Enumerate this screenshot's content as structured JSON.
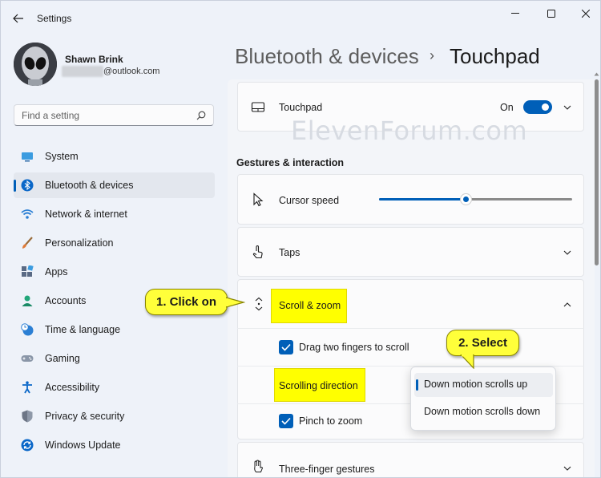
{
  "window": {
    "title": "Settings"
  },
  "profile": {
    "name": "Shawn Brink",
    "email_suffix": "@outlook.com"
  },
  "search": {
    "placeholder": "Find a setting"
  },
  "nav": {
    "items": [
      {
        "label": "System",
        "icon": "system-icon"
      },
      {
        "label": "Bluetooth & devices",
        "icon": "bluetooth-icon",
        "selected": true
      },
      {
        "label": "Network & internet",
        "icon": "wifi-icon"
      },
      {
        "label": "Personalization",
        "icon": "brush-icon"
      },
      {
        "label": "Apps",
        "icon": "apps-icon"
      },
      {
        "label": "Accounts",
        "icon": "person-icon"
      },
      {
        "label": "Time & language",
        "icon": "clock-globe-icon"
      },
      {
        "label": "Gaming",
        "icon": "gamepad-icon"
      },
      {
        "label": "Accessibility",
        "icon": "accessibility-icon"
      },
      {
        "label": "Privacy & security",
        "icon": "shield-icon"
      },
      {
        "label": "Windows Update",
        "icon": "update-icon"
      }
    ]
  },
  "breadcrumb": {
    "parent": "Bluetooth & devices",
    "separator": "›",
    "current": "Touchpad"
  },
  "touchpad": {
    "label": "Touchpad",
    "toggle_state": "On",
    "toggle_on": true
  },
  "gestures": {
    "section_title": "Gestures & interaction",
    "cursor_speed": {
      "label": "Cursor speed",
      "value_fraction": 0.45
    },
    "taps": {
      "label": "Taps"
    },
    "scroll_zoom": {
      "label": "Scroll & zoom",
      "drag_two_fingers": {
        "label": "Drag two fingers to scroll",
        "checked": true
      },
      "scrolling_direction": {
        "label": "Scrolling direction",
        "options": [
          "Down motion scrolls up",
          "Down motion scrolls down"
        ],
        "selected": "Down motion scrolls up"
      },
      "pinch_to_zoom": {
        "label": "Pinch to zoom",
        "checked": true
      }
    },
    "three_finger": {
      "label": "Three-finger gestures"
    }
  },
  "annotations": {
    "callout1": "1. Click on",
    "callout2": "2. Select"
  },
  "watermark": "ElevenForum.com",
  "colors": {
    "accent": "#005fb8",
    "highlight": "#ffff00",
    "callout": "#ffff3a"
  }
}
